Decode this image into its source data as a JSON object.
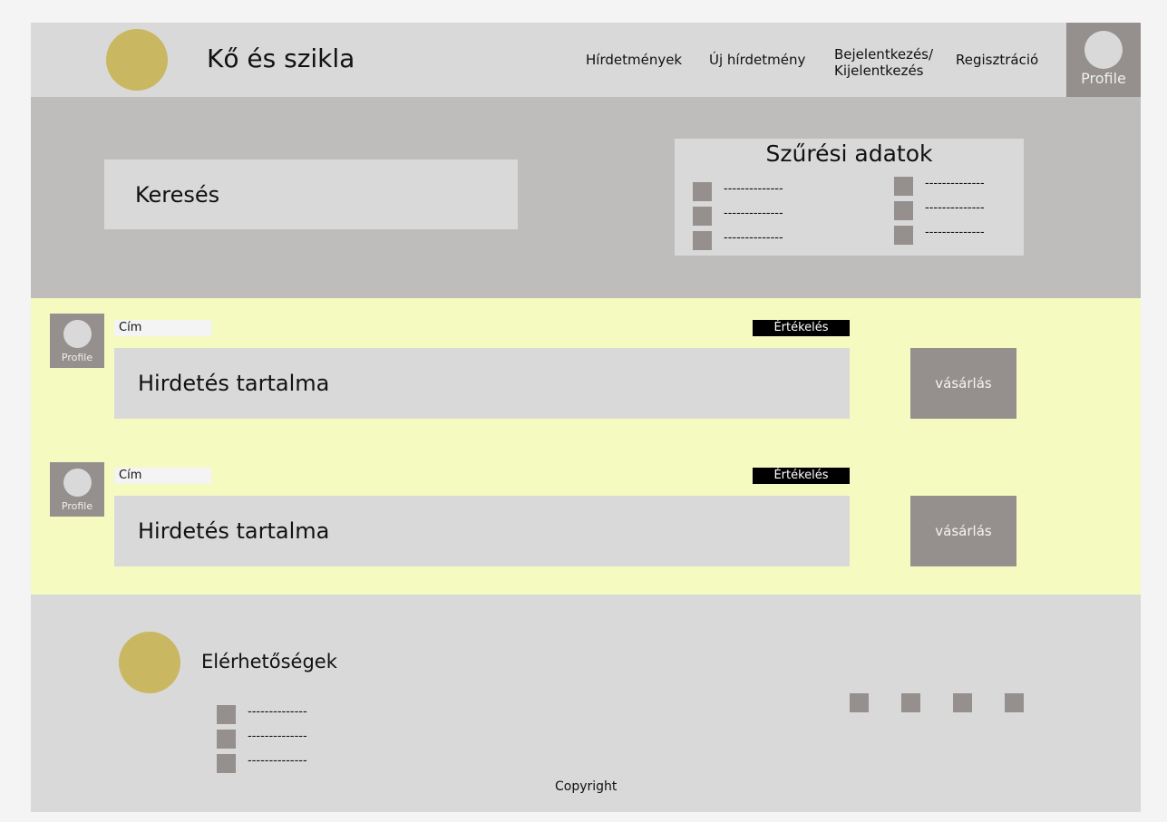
{
  "header": {
    "title": "Kő és szikla",
    "nav": [
      "Hírdetmények",
      "Új hírdetmény",
      "Bejelentkezés/\nKijelentkezés",
      "Regisztráció"
    ],
    "profile": "Profile"
  },
  "search": {
    "placeholder": "Keresés"
  },
  "filter": {
    "title": "Szűrési adatok",
    "options": [
      "--------------",
      "--------------",
      "--------------",
      "--------------",
      "--------------",
      "--------------"
    ]
  },
  "ads": [
    {
      "profile": "Profile",
      "title": "Cím",
      "rating": "Értékelés",
      "content": "Hirdetés tartalma",
      "buy": "vásárlás"
    },
    {
      "profile": "Profile",
      "title": "Cím",
      "rating": "Értékelés",
      "content": "Hirdetés tartalma",
      "buy": "vásárlás"
    }
  ],
  "footer": {
    "contacts_title": "Elérhetőségek",
    "contacts": [
      "--------------",
      "--------------",
      "--------------"
    ],
    "copyright": "Copyright"
  },
  "colors": {
    "header": "#d9d9d9",
    "search_band": "#bebdbb",
    "ads_band": "#f5fac0",
    "accent": "#c9b762",
    "square": "#958f8e"
  }
}
